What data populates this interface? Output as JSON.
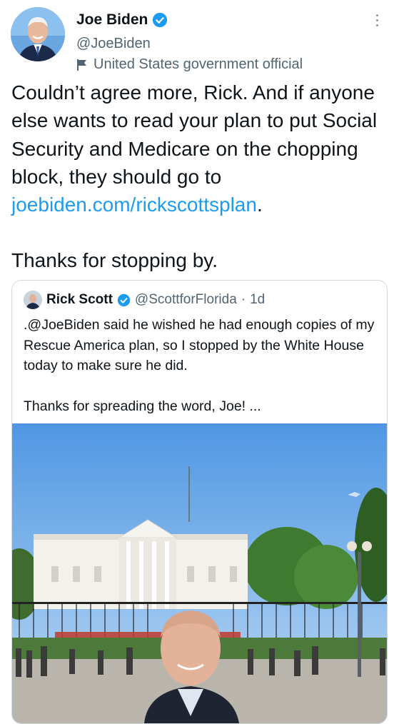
{
  "author": {
    "name": "Joe Biden",
    "handle": "@JoeBiden",
    "label": "United States government official"
  },
  "tweet": {
    "text_before_link": "Couldn’t agree more, Rick. And if anyone else wants to read your plan to put Social Security and Medicare on the chopping block, they should go to ",
    "link": "joebiden.com/rickscottsplan",
    "text_after_link": ".",
    "paragraph2": "Thanks for stopping by."
  },
  "quoted_tweet": {
    "name": "Rick Scott",
    "handle": "@ScottforFlorida",
    "separator": "·",
    "time": "1d",
    "paragraph1": ".@JoeBiden said he wished he had enough copies of my Rescue America plan, so I stopped by the White House today to make sure he did.",
    "paragraph2": "Thanks for spreading the word, Joe! ..."
  },
  "colors": {
    "link": "#1d9bf0",
    "verified": "#1d9bf0",
    "secondary_text": "#536471",
    "border": "#cfd9de"
  },
  "icons": {
    "verified": "verified-badge-icon",
    "label": "flag-icon",
    "more": "more-options-icon"
  }
}
